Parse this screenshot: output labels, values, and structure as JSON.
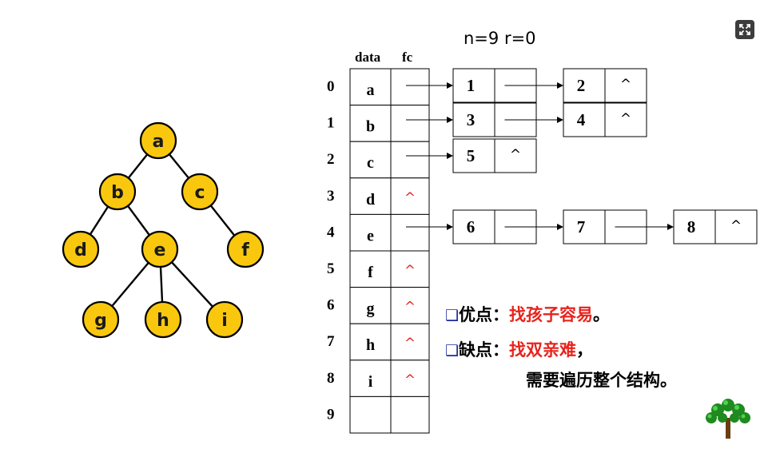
{
  "header": {
    "n_r": "n=9  r=0"
  },
  "tree": {
    "nodes": [
      {
        "id": "a",
        "label": "a"
      },
      {
        "id": "b",
        "label": "b"
      },
      {
        "id": "c",
        "label": "c"
      },
      {
        "id": "d",
        "label": "d"
      },
      {
        "id": "e",
        "label": "e"
      },
      {
        "id": "f",
        "label": "f"
      },
      {
        "id": "g",
        "label": "g"
      },
      {
        "id": "h",
        "label": "h"
      },
      {
        "id": "i",
        "label": "i"
      }
    ],
    "edges": [
      [
        "a",
        "b"
      ],
      [
        "a",
        "c"
      ],
      [
        "b",
        "d"
      ],
      [
        "b",
        "e"
      ],
      [
        "c",
        "f"
      ],
      [
        "e",
        "g"
      ],
      [
        "e",
        "h"
      ],
      [
        "e",
        "i"
      ]
    ]
  },
  "table": {
    "col_data": "data",
    "col_fc": "fc",
    "rows": [
      {
        "index": "0",
        "data": "a",
        "fc": ""
      },
      {
        "index": "1",
        "data": "b",
        "fc": ""
      },
      {
        "index": "2",
        "data": "c",
        "fc": ""
      },
      {
        "index": "3",
        "data": "d",
        "fc": "^"
      },
      {
        "index": "4",
        "data": "e",
        "fc": ""
      },
      {
        "index": "5",
        "data": "f",
        "fc": "^"
      },
      {
        "index": "6",
        "data": "g",
        "fc": "^"
      },
      {
        "index": "7",
        "data": "h",
        "fc": "^"
      },
      {
        "index": "8",
        "data": "i",
        "fc": "^"
      },
      {
        "index": "9",
        "data": "",
        "fc": ""
      }
    ]
  },
  "child_lists": [
    {
      "row": "0",
      "children": [
        "1",
        "2"
      ]
    },
    {
      "row": "1",
      "children": [
        "3",
        "4"
      ]
    },
    {
      "row": "2",
      "children": [
        "5"
      ]
    },
    {
      "row": "4",
      "children": [
        "6",
        "7",
        "8"
      ]
    }
  ],
  "null_symbol": "^",
  "notes": {
    "pro_label": "优点：",
    "pro_value": "找孩子容易",
    "pro_end": "。",
    "con_label": "缺点：",
    "con_value": "找双亲难",
    "con_end": "，",
    "con_line2": "需要遍历整个结构。"
  },
  "colors": {
    "node_fill": "#f9c80e",
    "red": "#e8231c",
    "bullet": "#1b2a9c"
  }
}
